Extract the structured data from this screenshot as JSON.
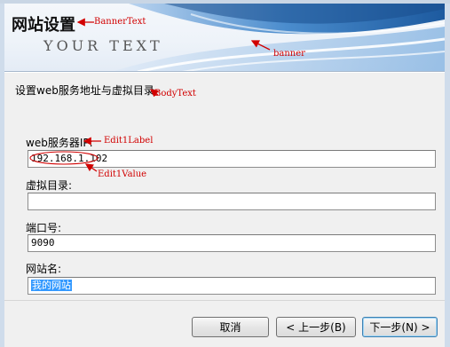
{
  "banner": {
    "title": "网站设置",
    "brand_text": "YOUR TEXT"
  },
  "body": {
    "text": "设置web服务地址与虚拟目录"
  },
  "fields": [
    {
      "label": "web服务器IP:",
      "value": "192.168.1.102"
    },
    {
      "label": "虚拟目录:",
      "value": ""
    },
    {
      "label": "端口号:",
      "value": "9090"
    },
    {
      "label": "网站名:",
      "value": "我的网站"
    }
  ],
  "buttons": {
    "cancel": "取消",
    "back": "< 上一步(B)",
    "next": "下一步(N) >"
  },
  "annotations": {
    "banner_text": "BannerText",
    "banner": "banner",
    "body_text": "BodyText",
    "edit1_label": "Edit1Label",
    "edit1_value": "Edit1Value"
  },
  "colors": {
    "annotation": "#d10000",
    "selection": "#3399ff",
    "banner_wave": "#2d6fb4"
  }
}
